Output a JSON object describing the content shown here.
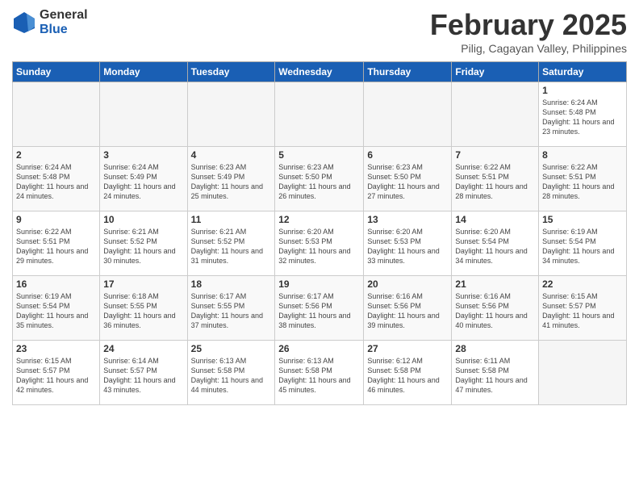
{
  "header": {
    "logo_general": "General",
    "logo_blue": "Blue",
    "title": "February 2025",
    "location": "Pilig, Cagayan Valley, Philippines"
  },
  "weekdays": [
    "Sunday",
    "Monday",
    "Tuesday",
    "Wednesday",
    "Thursday",
    "Friday",
    "Saturday"
  ],
  "weeks": [
    [
      {
        "day": "",
        "empty": true
      },
      {
        "day": "",
        "empty": true
      },
      {
        "day": "",
        "empty": true
      },
      {
        "day": "",
        "empty": true
      },
      {
        "day": "",
        "empty": true
      },
      {
        "day": "",
        "empty": true
      },
      {
        "day": "1",
        "sunrise": "6:24 AM",
        "sunset": "5:48 PM",
        "daylight": "11 hours and 23 minutes."
      }
    ],
    [
      {
        "day": "2",
        "sunrise": "6:24 AM",
        "sunset": "5:48 PM",
        "daylight": "11 hours and 24 minutes."
      },
      {
        "day": "3",
        "sunrise": "6:24 AM",
        "sunset": "5:49 PM",
        "daylight": "11 hours and 24 minutes."
      },
      {
        "day": "4",
        "sunrise": "6:23 AM",
        "sunset": "5:49 PM",
        "daylight": "11 hours and 25 minutes."
      },
      {
        "day": "5",
        "sunrise": "6:23 AM",
        "sunset": "5:50 PM",
        "daylight": "11 hours and 26 minutes."
      },
      {
        "day": "6",
        "sunrise": "6:23 AM",
        "sunset": "5:50 PM",
        "daylight": "11 hours and 27 minutes."
      },
      {
        "day": "7",
        "sunrise": "6:22 AM",
        "sunset": "5:51 PM",
        "daylight": "11 hours and 28 minutes."
      },
      {
        "day": "8",
        "sunrise": "6:22 AM",
        "sunset": "5:51 PM",
        "daylight": "11 hours and 28 minutes."
      }
    ],
    [
      {
        "day": "9",
        "sunrise": "6:22 AM",
        "sunset": "5:51 PM",
        "daylight": "11 hours and 29 minutes."
      },
      {
        "day": "10",
        "sunrise": "6:21 AM",
        "sunset": "5:52 PM",
        "daylight": "11 hours and 30 minutes."
      },
      {
        "day": "11",
        "sunrise": "6:21 AM",
        "sunset": "5:52 PM",
        "daylight": "11 hours and 31 minutes."
      },
      {
        "day": "12",
        "sunrise": "6:20 AM",
        "sunset": "5:53 PM",
        "daylight": "11 hours and 32 minutes."
      },
      {
        "day": "13",
        "sunrise": "6:20 AM",
        "sunset": "5:53 PM",
        "daylight": "11 hours and 33 minutes."
      },
      {
        "day": "14",
        "sunrise": "6:20 AM",
        "sunset": "5:54 PM",
        "daylight": "11 hours and 34 minutes."
      },
      {
        "day": "15",
        "sunrise": "6:19 AM",
        "sunset": "5:54 PM",
        "daylight": "11 hours and 34 minutes."
      }
    ],
    [
      {
        "day": "16",
        "sunrise": "6:19 AM",
        "sunset": "5:54 PM",
        "daylight": "11 hours and 35 minutes."
      },
      {
        "day": "17",
        "sunrise": "6:18 AM",
        "sunset": "5:55 PM",
        "daylight": "11 hours and 36 minutes."
      },
      {
        "day": "18",
        "sunrise": "6:17 AM",
        "sunset": "5:55 PM",
        "daylight": "11 hours and 37 minutes."
      },
      {
        "day": "19",
        "sunrise": "6:17 AM",
        "sunset": "5:56 PM",
        "daylight": "11 hours and 38 minutes."
      },
      {
        "day": "20",
        "sunrise": "6:16 AM",
        "sunset": "5:56 PM",
        "daylight": "11 hours and 39 minutes."
      },
      {
        "day": "21",
        "sunrise": "6:16 AM",
        "sunset": "5:56 PM",
        "daylight": "11 hours and 40 minutes."
      },
      {
        "day": "22",
        "sunrise": "6:15 AM",
        "sunset": "5:57 PM",
        "daylight": "11 hours and 41 minutes."
      }
    ],
    [
      {
        "day": "23",
        "sunrise": "6:15 AM",
        "sunset": "5:57 PM",
        "daylight": "11 hours and 42 minutes."
      },
      {
        "day": "24",
        "sunrise": "6:14 AM",
        "sunset": "5:57 PM",
        "daylight": "11 hours and 43 minutes."
      },
      {
        "day": "25",
        "sunrise": "6:13 AM",
        "sunset": "5:58 PM",
        "daylight": "11 hours and 44 minutes."
      },
      {
        "day": "26",
        "sunrise": "6:13 AM",
        "sunset": "5:58 PM",
        "daylight": "11 hours and 45 minutes."
      },
      {
        "day": "27",
        "sunrise": "6:12 AM",
        "sunset": "5:58 PM",
        "daylight": "11 hours and 46 minutes."
      },
      {
        "day": "28",
        "sunrise": "6:11 AM",
        "sunset": "5:58 PM",
        "daylight": "11 hours and 47 minutes."
      },
      {
        "day": "",
        "empty": true
      }
    ]
  ]
}
